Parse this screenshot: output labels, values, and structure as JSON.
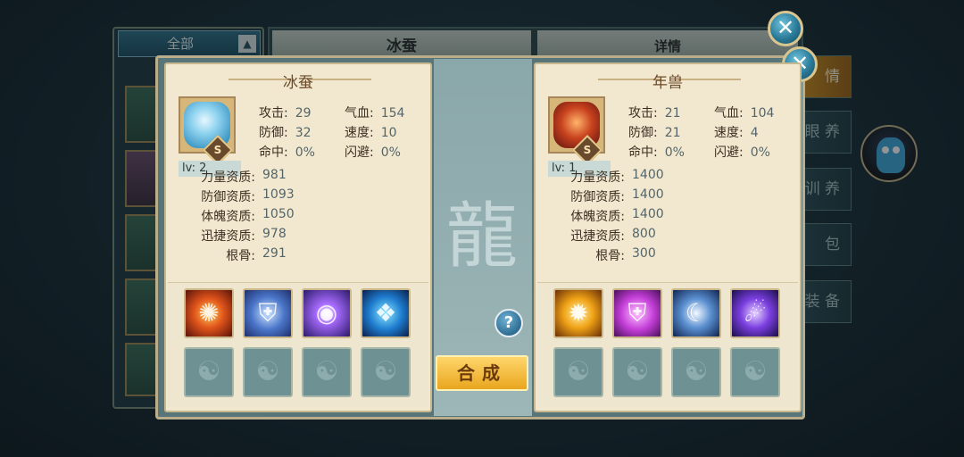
{
  "background": {
    "filter_label": "全部",
    "title": "冰蚕",
    "tab_detail": "详情",
    "side_tabs": [
      "情",
      "眼 养",
      "训 养",
      "包",
      "装 备"
    ]
  },
  "colors": {
    "accent_gold": "#e9a61f",
    "panel_bg": "#f1e8cf",
    "teal": "#58767a"
  },
  "left_pet": {
    "name": "冰蚕",
    "rank": "S",
    "level": "lv: 2",
    "stats": [
      {
        "label": "攻击:",
        "value": "29"
      },
      {
        "label": "气血:",
        "value": "154"
      },
      {
        "label": "防御:",
        "value": "32"
      },
      {
        "label": "速度:",
        "value": "10"
      },
      {
        "label": "命中:",
        "value": "0%"
      },
      {
        "label": "闪避:",
        "value": "0%"
      }
    ],
    "aptitudes": [
      {
        "label": "力量资质:",
        "value": "981"
      },
      {
        "label": "防御资质:",
        "value": "1093"
      },
      {
        "label": "体魄资质:",
        "value": "1050"
      },
      {
        "label": "迅捷资质:",
        "value": "978"
      },
      {
        "label": "根骨:",
        "value": "291"
      }
    ],
    "skills": [
      "fire-dragon-skill-icon",
      "shield-skill-icon",
      "vortex-skill-icon",
      "ice-beast-skill-icon"
    ]
  },
  "right_pet": {
    "name": "年兽",
    "rank": "S",
    "level": "lv: 1",
    "stats": [
      {
        "label": "攻击:",
        "value": "21"
      },
      {
        "label": "气血:",
        "value": "104"
      },
      {
        "label": "防御:",
        "value": "21"
      },
      {
        "label": "速度:",
        "value": "4"
      },
      {
        "label": "命中:",
        "value": "0%"
      },
      {
        "label": "闪避:",
        "value": "0%"
      }
    ],
    "aptitudes": [
      {
        "label": "力量资质:",
        "value": "1400"
      },
      {
        "label": "防御资质:",
        "value": "1400"
      },
      {
        "label": "体魄资质:",
        "value": "1400"
      },
      {
        "label": "迅捷资质:",
        "value": "800"
      },
      {
        "label": "根骨:",
        "value": "300"
      }
    ],
    "skills": [
      "golden-blast-skill-icon",
      "guard-skill-icon",
      "moon-slash-skill-icon",
      "purple-wave-skill-icon"
    ]
  },
  "buttons": {
    "help": "?",
    "merge": "合成",
    "close": "✕"
  }
}
